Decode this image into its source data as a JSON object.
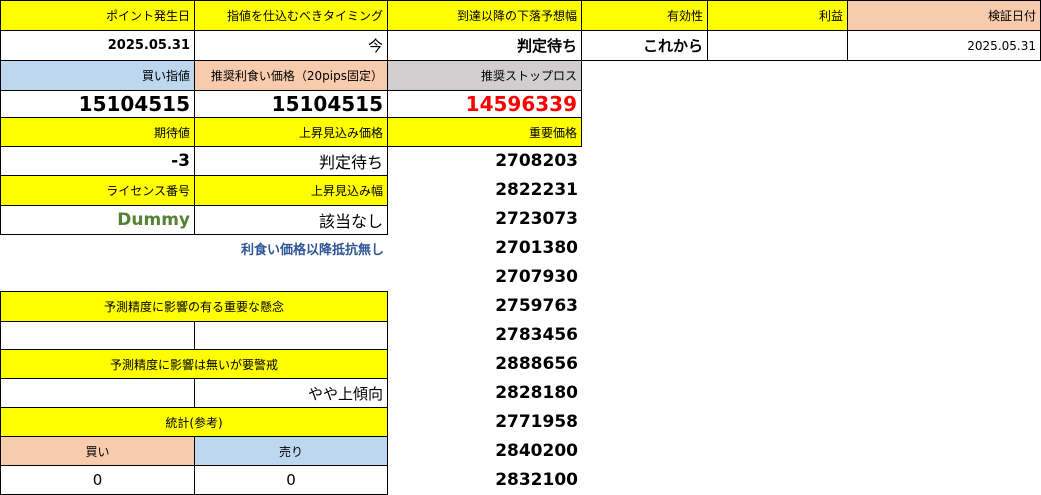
{
  "row1": {
    "point_date_label": "ポイント発生日",
    "timing_label": "指値を仕込むべきタイミング",
    "drop_forecast_label": "到達以降の下落予想幅",
    "validity_label": "有効性",
    "profit_label": "利益",
    "verify_date_label": "検証日付"
  },
  "row2": {
    "point_date": "2025.05.31",
    "timing": "今",
    "drop_forecast": "判定待ち",
    "validity": "これから",
    "profit": "",
    "verify_date": "2025.05.31"
  },
  "row3": {
    "buy_limit_label": "買い指値",
    "take_profit_label": "推奨利食い価格（20pips固定）",
    "stop_loss_label": "推奨ストップロス"
  },
  "row4": {
    "buy_limit": "15104515",
    "take_profit": "15104515",
    "stop_loss": "14596339"
  },
  "row5": {
    "expected_value_label": "期待値",
    "rise_price_label": "上昇見込み価格",
    "important_price_label": "重要価格"
  },
  "row6": {
    "expected_value": "-3",
    "rise_price": "判定待ち"
  },
  "row7": {
    "license_label": "ライセンス番号",
    "rise_width_label": "上昇見込み幅"
  },
  "row8": {
    "license": "Dummy",
    "rise_width": "該当なし"
  },
  "note_no_resistance": "利食い価格以降抵抗無し",
  "concern_label": "予測精度に影響の有る重要な懸念",
  "concern_left": "",
  "concern_right": "",
  "warning_label": "予測精度に影響は無いが要警戒",
  "warning_left": "",
  "warning_right": "やや上傾向",
  "stats_label": "統計(参考)",
  "stats_buy_label": "買い",
  "stats_sell_label": "売り",
  "stats_buy": "0",
  "stats_sell": "0",
  "important_prices": [
    "2708203",
    "2822231",
    "2723073",
    "2701380",
    "2707930",
    "2759763",
    "2783456",
    "2888656",
    "2828180",
    "2771958",
    "2840200",
    "2832100"
  ],
  "colors": {
    "yellow": "#ffff00",
    "salmon": "#f8cbad",
    "light_blue": "#bdd7ee",
    "gray": "#d0cece",
    "stop_loss_red": "#ff0000",
    "license_green": "#548235",
    "note_blue": "#2f5597"
  }
}
